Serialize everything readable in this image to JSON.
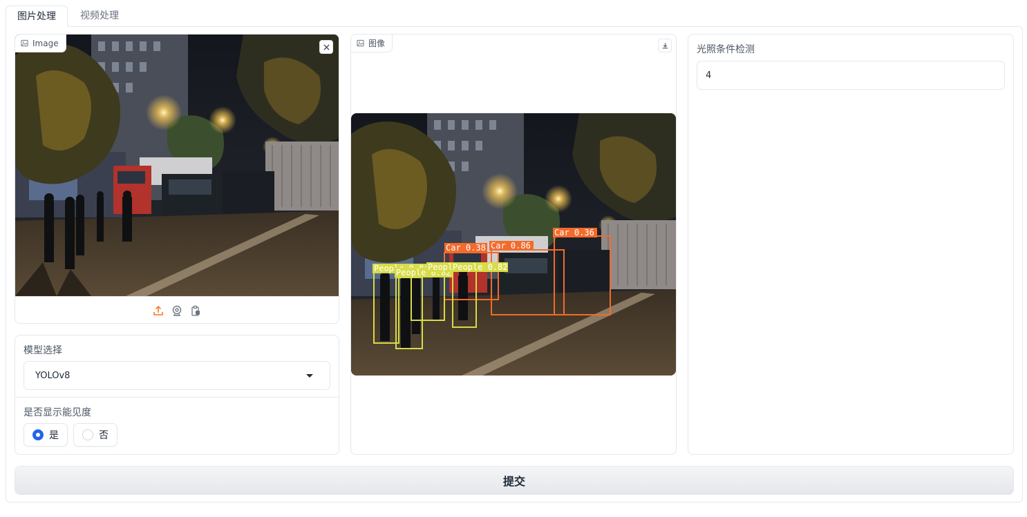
{
  "tabs": [
    {
      "label": "图片处理",
      "active": true
    },
    {
      "label": "视频处理",
      "active": false
    }
  ],
  "input_image": {
    "label": "Image",
    "tools": [
      "upload-icon",
      "webcam-icon",
      "clipboard-icon"
    ]
  },
  "output_image": {
    "label": "图像",
    "detections": [
      {
        "label": "Car 0.38",
        "class": "Car"
      },
      {
        "label": "Car 0.86",
        "class": "Car"
      },
      {
        "label": "Car 0.36",
        "class": "Car"
      },
      {
        "label": "People 0.84",
        "class": "People"
      },
      {
        "label": "People 0.82",
        "class": "People"
      },
      {
        "label": "People",
        "class": "People"
      },
      {
        "label": "People 0.82",
        "class": "People"
      }
    ]
  },
  "model_select": {
    "label": "模型选择",
    "value": "YOLOv8"
  },
  "visibility": {
    "label": "是否显示能见度",
    "options": [
      {
        "label": "是",
        "checked": true
      },
      {
        "label": "否",
        "checked": false
      }
    ]
  },
  "lighting": {
    "label": "光照条件检测",
    "value": "4"
  },
  "submit_label": "提交",
  "colors": {
    "accent": "#f97316",
    "radio_checked": "#2563eb",
    "car_box": "#f36b2c",
    "people_box": "#d7dc47"
  }
}
